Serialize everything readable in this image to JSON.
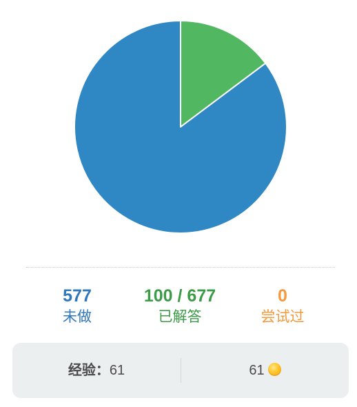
{
  "chart_data": {
    "type": "pie",
    "slices": [
      {
        "label": "已解答",
        "value": 100,
        "color": "#52b761"
      },
      {
        "label": "未做",
        "value": 577,
        "color": "#2f87c4"
      },
      {
        "label": "尝试过",
        "value": 0,
        "color": "#f59b3a"
      }
    ],
    "start_angle_deg": 0,
    "direction": "clockwise",
    "slice_border_color": "#ffffff"
  },
  "stats": {
    "todo": {
      "value": "577",
      "label": "未做",
      "color": "#2f77b8"
    },
    "solved": {
      "value": "100 / 677",
      "label": "已解答",
      "color": "#3b9b46"
    },
    "tried": {
      "value": "0",
      "label": "尝试过",
      "color": "#f39a3c"
    }
  },
  "footer": {
    "exp_label": "经验：",
    "exp_value": "61",
    "coins_value": "61",
    "coin_icon": "gold-coin-icon"
  }
}
